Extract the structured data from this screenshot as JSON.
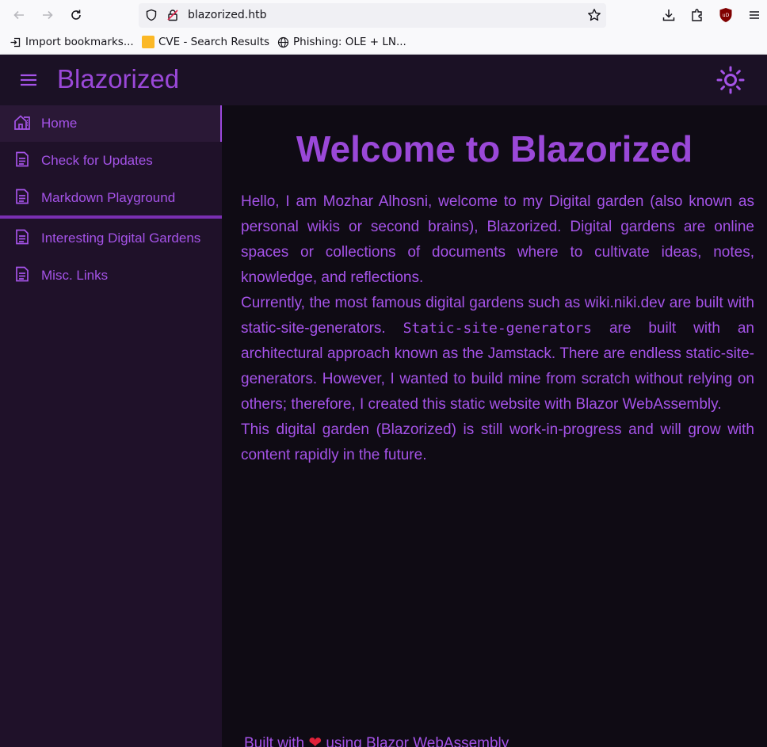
{
  "browser": {
    "url": "blazorized.htb",
    "bookmarks": [
      {
        "label": "Import bookmarks...",
        "icon": "import-icon"
      },
      {
        "label": "CVE - Search Results",
        "icon": "folder-favicon"
      },
      {
        "label": "Phishing: OLE + LN...",
        "icon": "globe-icon"
      }
    ]
  },
  "header": {
    "brand": "Blazorized",
    "menu_icon": "hamburger-icon",
    "theme_icon": "sun-icon"
  },
  "sidebar": {
    "items": [
      {
        "label": "Home",
        "icon": "home-icon",
        "active": true
      },
      {
        "label": "Check for Updates",
        "icon": "document-icon"
      },
      {
        "label": "Markdown Playground",
        "icon": "document-icon"
      },
      {
        "label": "Interesting Digital Gardens",
        "icon": "document-icon"
      },
      {
        "label": "Misc. Links",
        "icon": "document-icon"
      }
    ]
  },
  "main": {
    "title": "Welcome to Blazorized",
    "paragraphs": {
      "p1": "Hello, I am Mozhar Alhosni, welcome to my Digital garden (also known as personal wikis or second brains), Blazorized. Digital gardens are online spaces or collections of documents where to cultivate ideas, notes, knowledge, and reflections.",
      "p2_before": "Currently, the most famous digital gardens such as wiki.niki.dev are built with static-site-generators. ",
      "p2_code": "Static-site-generators",
      "p2_after": " are built with an architectural approach known as the Jamstack. There are endless static-site-generators. However, I wanted to build mine from scratch without relying on others; therefore, I created this static website with Blazor WebAssembly.",
      "p3": "This digital garden (Blazorized) is still work-in-progress and will grow with content rapidly in the future."
    },
    "footer": {
      "before": "Built with ",
      "heart": "❤",
      "after": " using Blazor WebAssembly"
    }
  },
  "colors": {
    "accent": "#9a48d8",
    "sidebar_bg": "#1f1129",
    "main_bg": "#0f0b14",
    "header_bg": "#1b1125"
  }
}
